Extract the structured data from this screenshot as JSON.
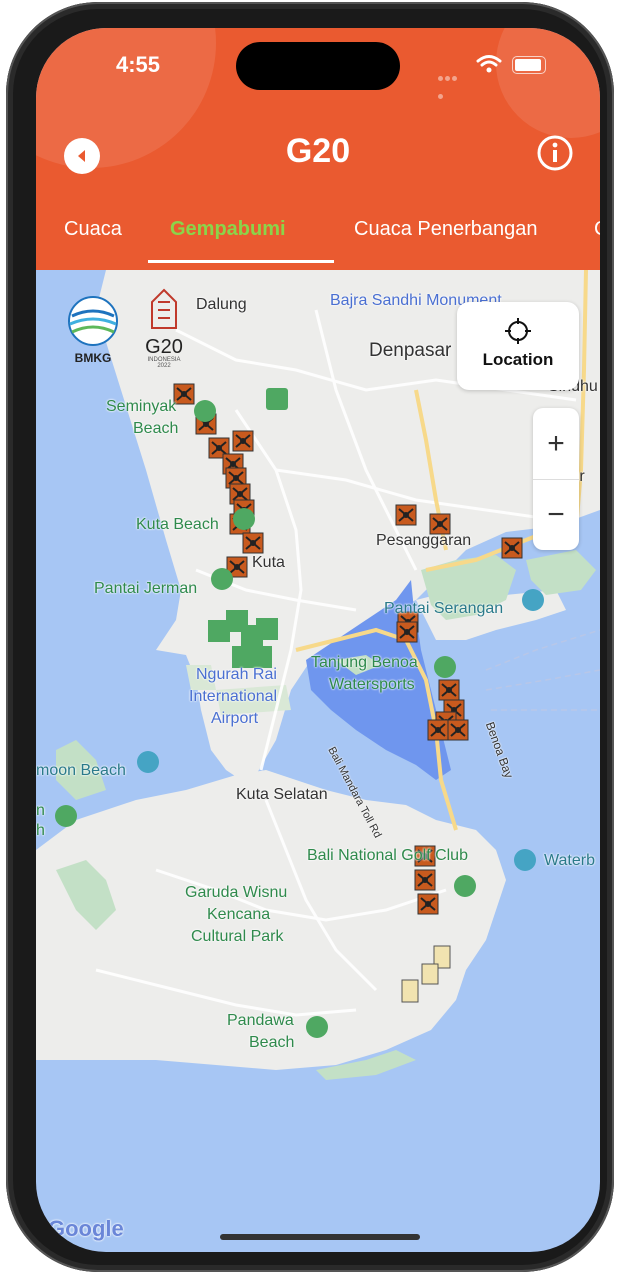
{
  "status": {
    "time": "4:55"
  },
  "header": {
    "title": "G20"
  },
  "tabs": [
    {
      "label": "Cuaca",
      "active": false
    },
    {
      "label": "Gempabumi",
      "active": true
    },
    {
      "label": "Cuaca Penerbangan",
      "active": false
    },
    {
      "label": "C",
      "active": false
    }
  ],
  "logos": {
    "bmkg": "BMKG",
    "g20": "G20",
    "g20_sub": "INDONESIA",
    "g20_year": "2022"
  },
  "map": {
    "labels": {
      "dalung": "Dalung",
      "bajra": "Bajra Sandhi Monument",
      "denpasar": "Denpasar",
      "sindhu": "Sindhu",
      "seminyak1": "Seminyak",
      "seminyak2": "Beach",
      "kuta_beach": "Kuta Beach",
      "pesanggaran": "Pesanggaran",
      "kuta": "Kuta",
      "pantai_jerman": "Pantai Jerman",
      "pantai_serangan": "Pantai Serangan",
      "tanjung1": "Tanjung Benoa",
      "tanjung2": "Watersports",
      "airport1": "Ngurah Rai",
      "airport2": "International",
      "airport3": "Airport",
      "toll": "Bali Mandara Toll Rd",
      "benoa_bay": "Benoa Bay",
      "moon_beach": "moon Beach",
      "n": "n",
      "h": "h",
      "kuta_selatan": "Kuta Selatan",
      "bali_national": "Bali National Golf Club",
      "waterbom": "Waterb",
      "gwk1": "Garuda Wisnu",
      "gwk2": "Kencana",
      "gwk3": "Cultural Park",
      "pandawa1": "Pandawa",
      "pandawa2": "Beach",
      "google": "Google",
      "tur": "tur"
    },
    "location_button": "Location",
    "zoom_in": "+",
    "zoom_out": "−"
  },
  "colors": {
    "header": "#ea5a30",
    "active_tab": "#8bd44a",
    "water": "#a7c6f4",
    "land": "#ededeb"
  }
}
